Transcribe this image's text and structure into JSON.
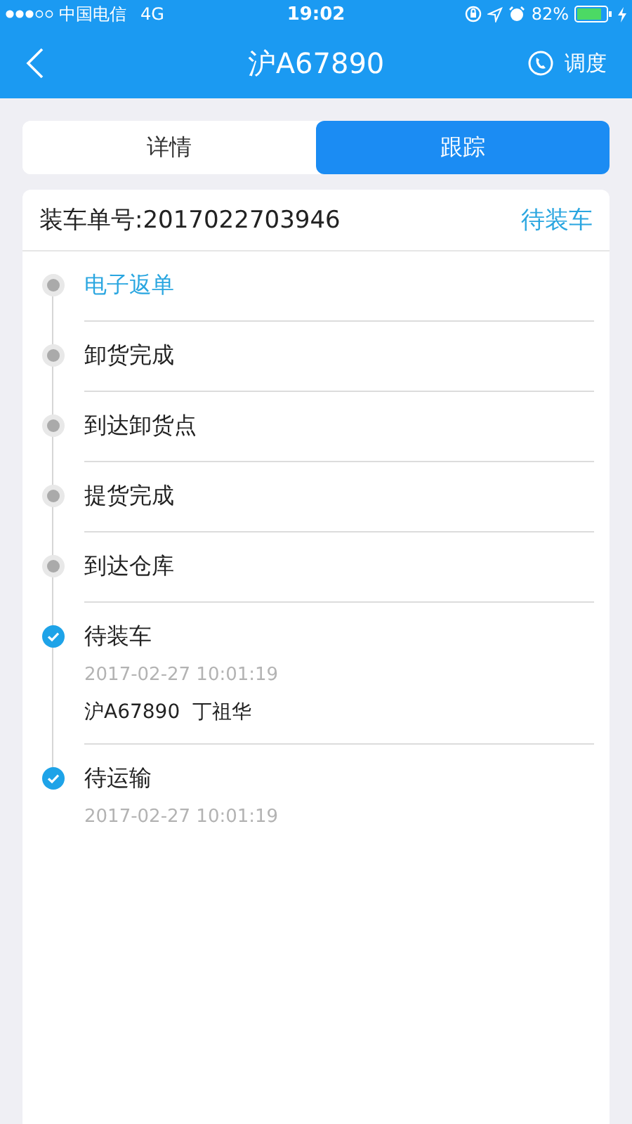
{
  "status_bar": {
    "carrier": "中国电信",
    "network": "4G",
    "time": "19:02",
    "battery": "82%"
  },
  "header": {
    "title": "沪A67890",
    "action": "调度"
  },
  "tabs": [
    {
      "label": "详情",
      "selected": false
    },
    {
      "label": "跟踪",
      "selected": true
    }
  ],
  "order": {
    "label": "装车单号:2017022703946",
    "status": "待装车"
  },
  "steps": [
    {
      "kind": "pending",
      "title": "电子返单",
      "highlighted": true
    },
    {
      "kind": "pending",
      "title": "卸货完成",
      "highlighted": false
    },
    {
      "kind": "pending",
      "title": "到达卸货点",
      "highlighted": false
    },
    {
      "kind": "pending",
      "title": "提货完成",
      "highlighted": false
    },
    {
      "kind": "pending",
      "title": "到达仓库",
      "highlighted": false
    },
    {
      "kind": "done",
      "title": "待装车",
      "highlighted": false,
      "time": "2017-02-27 10:01:19",
      "detail": "沪A67890  丁祖华"
    },
    {
      "kind": "done",
      "title": "待运输",
      "highlighted": false,
      "time": "2017-02-27 10:01:19"
    }
  ]
}
